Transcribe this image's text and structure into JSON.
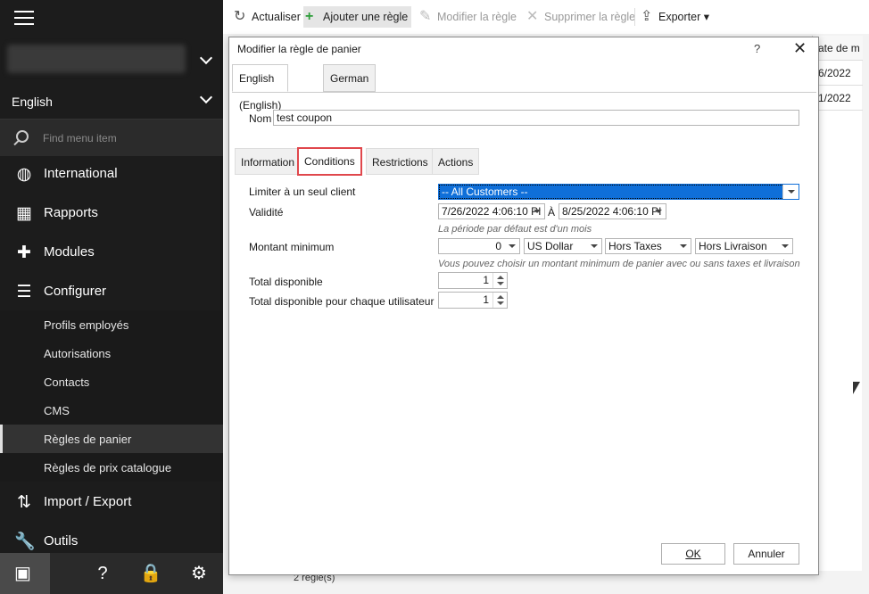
{
  "sidebar": {
    "language": "English",
    "search_placeholder": "Find menu item",
    "items": [
      {
        "label": "International",
        "icon": "globe-icon"
      },
      {
        "label": "Rapports",
        "icon": "chart-icon"
      },
      {
        "label": "Modules",
        "icon": "puzzle-icon"
      },
      {
        "label": "Configurer",
        "icon": "sliders-icon"
      }
    ],
    "subitems": [
      {
        "label": "Profils employés"
      },
      {
        "label": "Autorisations"
      },
      {
        "label": "Contacts"
      },
      {
        "label": "CMS"
      },
      {
        "label": "Règles de panier"
      },
      {
        "label": "Règles de prix catalogue"
      }
    ],
    "items2": [
      {
        "label": "Import / Export",
        "icon": "import-export-icon"
      },
      {
        "label": "Outils",
        "icon": "wrench-icon"
      }
    ]
  },
  "toolbar": {
    "refresh": "Actualiser",
    "add": "Ajouter une règle",
    "edit": "Modifier la règle",
    "delete": "Supprimer la règle",
    "export": "Exporter"
  },
  "grid": {
    "header": "ate de m",
    "rows": [
      "6/2022",
      "1/2022"
    ]
  },
  "status": "2 règle(s)",
  "dialog": {
    "title": "Modifier la règle de panier",
    "help": "?",
    "close": "✕",
    "lang_tabs": [
      "English (English)",
      "German"
    ],
    "name_label": "Nom",
    "name_value": "test coupon",
    "tabs": [
      "Information",
      "Conditions",
      "Restrictions",
      "Actions"
    ],
    "customer_label": "Limiter à un seul client",
    "customer_value": "-- All Customers --",
    "validity_label": "Validité",
    "date_from": "7/26/2022 4:06:10 PI",
    "date_sep": "À",
    "date_to": "8/25/2022 4:06:10 PI",
    "validity_hint": "La période par défaut est d'un mois",
    "min_label": "Montant minimum",
    "min_value": "0",
    "currency": "US Dollar",
    "tax": "Hors Taxes",
    "shipping": "Hors Livraison",
    "min_hint": "Vous pouvez choisir un montant minimum de panier avec ou sans taxes et livraison",
    "total_label": "Total disponible",
    "total_value": "1",
    "total_user_label": "Total disponible pour chaque utilisateur",
    "total_user_value": "1",
    "ok": "OK",
    "cancel": "Annuler"
  }
}
